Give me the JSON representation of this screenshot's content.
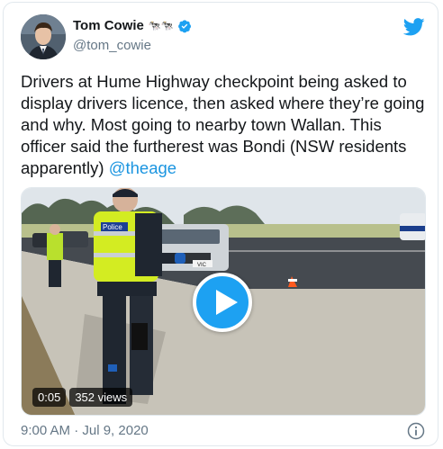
{
  "author": {
    "name": "Tom Cowie",
    "emoji": "🐄🐄",
    "handle": "@tom_cowie",
    "verified": true
  },
  "tweet": {
    "text": "Drivers at Hume Highway checkpoint being asked to display drivers licence, then asked where they’re going and why. Most going to nearby town Wallan. This officer said the furtherest was Bondi (NSW residents apparently) ",
    "mention": "@theage"
  },
  "video": {
    "duration": "0:05",
    "views": "352 views",
    "vest_text": "Police",
    "plate_text": "VIC"
  },
  "timestamp": "9:00 AM · Jul 9, 2020",
  "colors": {
    "brand": "#1da1f2",
    "link": "#1b95e0",
    "muted": "#657786",
    "text": "#14171a"
  },
  "icons": [
    "twitter-bird-icon",
    "verified-badge-icon",
    "play-icon",
    "info-icon"
  ]
}
